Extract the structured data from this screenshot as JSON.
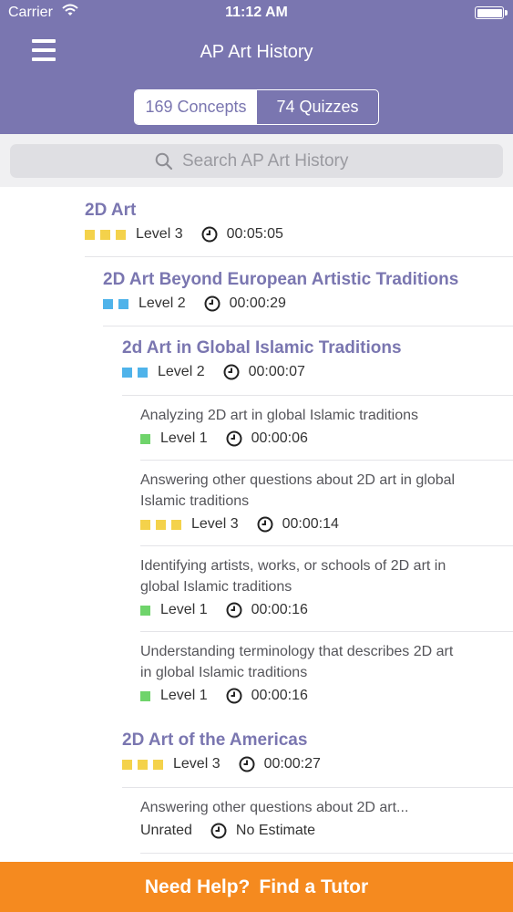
{
  "status_bar": {
    "carrier": "Carrier",
    "time": "11:12 AM"
  },
  "header": {
    "title": "AP Art History"
  },
  "tabs": [
    {
      "label": "169 Concepts",
      "active": true
    },
    {
      "label": "74 Quizzes",
      "active": false
    }
  ],
  "search": {
    "placeholder": "Search AP Art History"
  },
  "colors": {
    "header": "#7a76b0",
    "level_1": "#6fd46b",
    "level_2": "#4fb3ea",
    "level_3": "#f4d24b",
    "footer": "#f58a1f"
  },
  "items": [
    {
      "title": "2D Art",
      "level": "Level 3",
      "time": "00:05:05"
    },
    {
      "title": "2D Art Beyond European Artistic Traditions",
      "level": "Level 2",
      "time": "00:00:29"
    },
    {
      "title": "2d Art in Global Islamic Traditions",
      "level": "Level 2",
      "time": "00:00:07"
    },
    {
      "title": "Analyzing 2D art in global Islamic traditions",
      "level": "Level 1",
      "time": "00:00:06"
    },
    {
      "title_lines": [
        "Answering other questions about 2D art in global",
        "Islamic traditions"
      ],
      "level": "Level 3",
      "time": "00:00:14"
    },
    {
      "title_lines": [
        "Identifying artists, works, or schools of 2D art in",
        "global Islamic traditions"
      ],
      "level": "Level 1",
      "time": "00:00:16"
    },
    {
      "title_lines": [
        "Understanding terminology that describes 2D art",
        "in global Islamic traditions"
      ],
      "level": "Level 1",
      "time": "00:00:16"
    },
    {
      "title": "2D Art of the Americas",
      "level": "Level 3",
      "time": "00:00:27"
    },
    {
      "title": "Answering other questions about 2D art...",
      "level": "Unrated",
      "time": "No Estimate"
    }
  ],
  "footer": {
    "part1": "Need Help?",
    "part2": "Find a Tutor"
  }
}
